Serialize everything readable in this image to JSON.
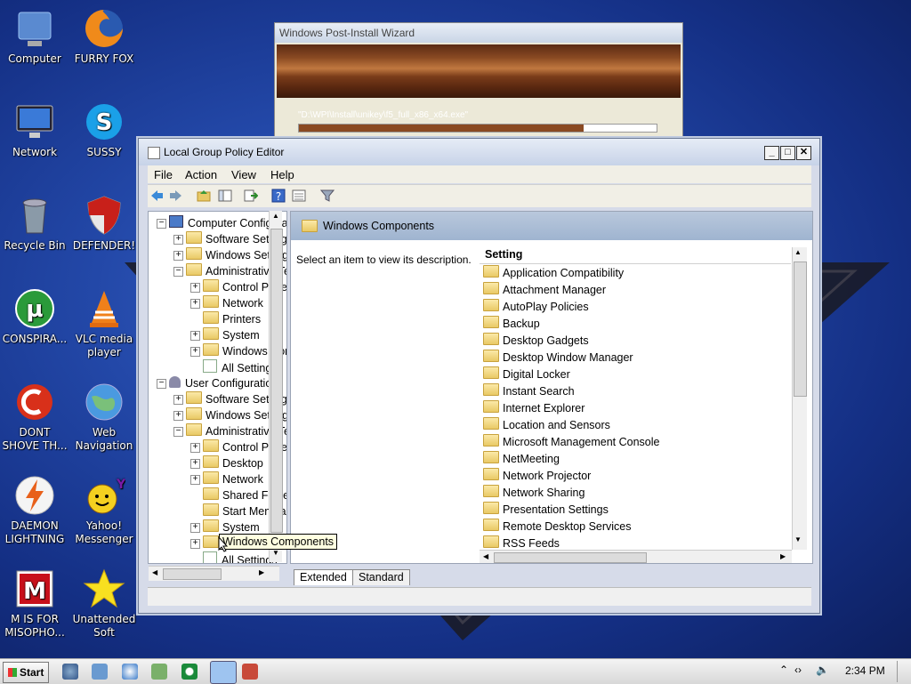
{
  "desktop": {
    "icons": [
      {
        "label": "Computer",
        "icon": "computer-icon"
      },
      {
        "label": "FURRY FOX",
        "icon": "firefox-icon"
      },
      {
        "label": "Network",
        "icon": "network-icon"
      },
      {
        "label": "SUSSY",
        "icon": "skype-icon"
      },
      {
        "label": "Recycle Bin",
        "icon": "recycle-bin-icon"
      },
      {
        "label": "DEFENDER!",
        "icon": "shield-icon"
      },
      {
        "label": "CONSPIRA...",
        "icon": "utorrent-icon"
      },
      {
        "label": "VLC media player",
        "icon": "vlc-icon"
      },
      {
        "label": "DONT SHOVE TH...",
        "icon": "ccleaner-icon"
      },
      {
        "label": "Web Navigation",
        "icon": "globe-icon"
      },
      {
        "label": "DAEMON LIGHTNING",
        "icon": "daemon-tools-icon"
      },
      {
        "label": "Yahoo! Messenger",
        "icon": "yahoo-messenger-icon"
      },
      {
        "label": "M IS FOR MISOPHO...",
        "icon": "mcafee-icon"
      },
      {
        "label": "Unattended Soft",
        "icon": "star-icon"
      }
    ]
  },
  "wizard": {
    "title": "Windows Post-Install Wizard",
    "path": "\"D:\\WPI\\Install\\unikey\\f5_full_x86_x64.exe\""
  },
  "gpo": {
    "title": "Local Group Policy Editor",
    "menu": [
      "File",
      "Action",
      "View",
      "Help"
    ],
    "tree": [
      {
        "label": "Computer Configuration",
        "level": 0,
        "expander": "−",
        "icon": "computer"
      },
      {
        "label": "Software Settings",
        "level": 1,
        "expander": "+",
        "icon": "folder"
      },
      {
        "label": "Windows Settings",
        "level": 1,
        "expander": "+",
        "icon": "folder"
      },
      {
        "label": "Administrative Templates",
        "level": 1,
        "expander": "−",
        "icon": "folder"
      },
      {
        "label": "Control Panel",
        "level": 2,
        "expander": "+",
        "icon": "folder"
      },
      {
        "label": "Network",
        "level": 2,
        "expander": "+",
        "icon": "folder"
      },
      {
        "label": "Printers",
        "level": 2,
        "expander": "",
        "icon": "folder"
      },
      {
        "label": "System",
        "level": 2,
        "expander": "+",
        "icon": "folder"
      },
      {
        "label": "Windows Components",
        "level": 2,
        "expander": "+",
        "icon": "folder"
      },
      {
        "label": "All Settings",
        "level": 2,
        "expander": "",
        "icon": "settings"
      },
      {
        "label": "User Configuration",
        "level": 0,
        "expander": "−",
        "icon": "user"
      },
      {
        "label": "Software Settings",
        "level": 1,
        "expander": "+",
        "icon": "folder"
      },
      {
        "label": "Windows Settings",
        "level": 1,
        "expander": "+",
        "icon": "folder"
      },
      {
        "label": "Administrative Templates",
        "level": 1,
        "expander": "−",
        "icon": "folder"
      },
      {
        "label": "Control Panel",
        "level": 2,
        "expander": "+",
        "icon": "folder"
      },
      {
        "label": "Desktop",
        "level": 2,
        "expander": "+",
        "icon": "folder"
      },
      {
        "label": "Network",
        "level": 2,
        "expander": "+",
        "icon": "folder"
      },
      {
        "label": "Shared Folders",
        "level": 2,
        "expander": "",
        "icon": "folder"
      },
      {
        "label": "Start Menu and Taskbar",
        "level": 2,
        "expander": "",
        "icon": "folder"
      },
      {
        "label": "System",
        "level": 2,
        "expander": "+",
        "icon": "folder"
      },
      {
        "label": "Windows Components",
        "level": 2,
        "expander": "+",
        "icon": "folder"
      },
      {
        "label": "All Settings",
        "level": 2,
        "expander": "",
        "icon": "settings"
      }
    ],
    "header_title": "Windows Components",
    "description": "Select an item to view its description.",
    "column_header": "Setting",
    "items": [
      "Application Compatibility",
      "Attachment Manager",
      "AutoPlay Policies",
      "Backup",
      "Desktop Gadgets",
      "Desktop Window Manager",
      "Digital Locker",
      "Instant Search",
      "Internet Explorer",
      "Location and Sensors",
      "Microsoft Management Console",
      "NetMeeting",
      "Network Projector",
      "Network Sharing",
      "Presentation Settings",
      "Remote Desktop Services",
      "RSS Feeds"
    ],
    "tabs": [
      "Extended",
      "Standard"
    ],
    "tooltip": "Windows Components"
  },
  "taskbar": {
    "start_label": "Start",
    "clock": "2:34 PM"
  }
}
